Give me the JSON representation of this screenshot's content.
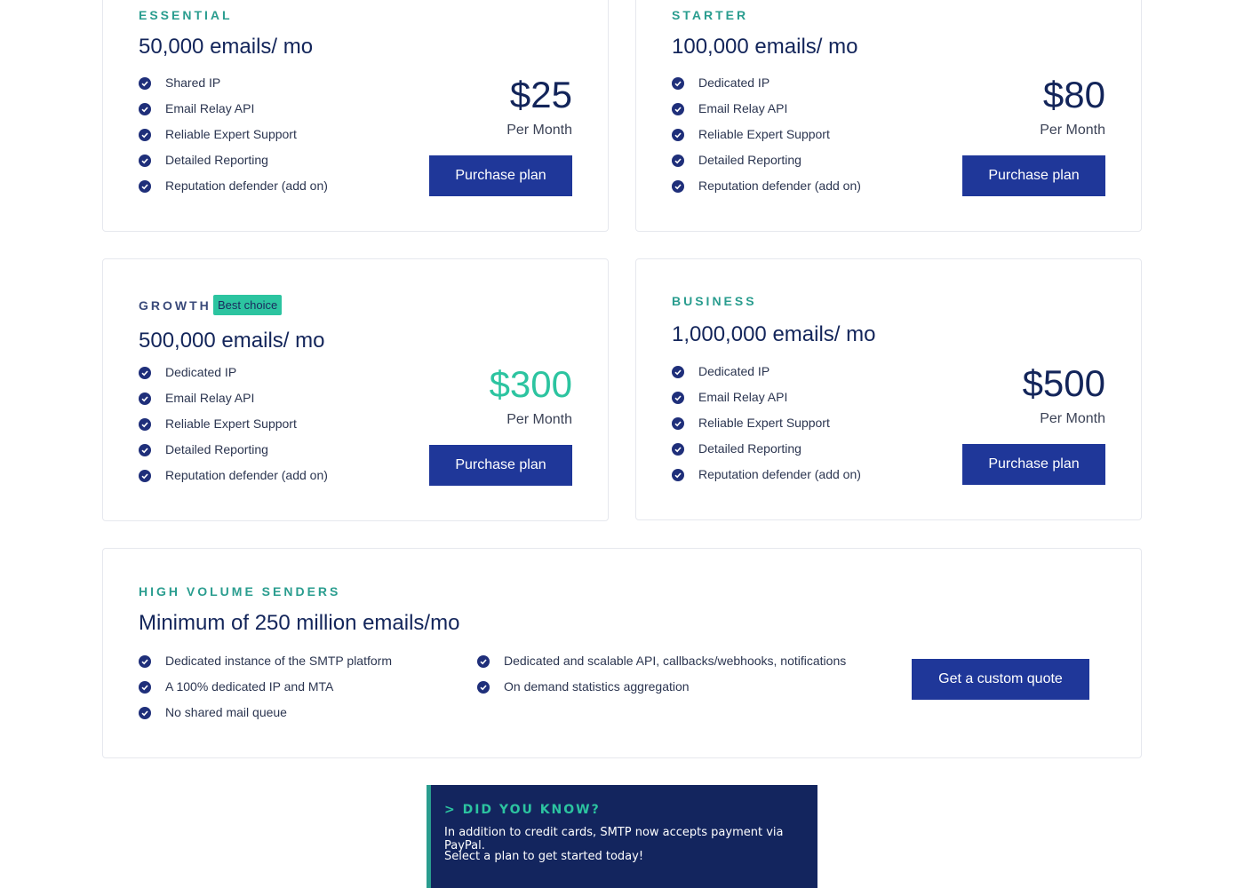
{
  "colors": {
    "navy": "#13255a",
    "button": "#1f3799",
    "teal": "#2a9d8f",
    "accent": "#2cc4a0",
    "check": "#1f2f7a"
  },
  "check_icon": "check-circle-icon",
  "plans": [
    {
      "tier": "ESSENTIAL",
      "volume": "50,000 emails/ mo",
      "features": [
        "Shared IP",
        "Email Relay API",
        "Reliable Expert Support",
        "Detailed Reporting",
        "Reputation defender (add on)"
      ],
      "price": "$25",
      "per": "Per Month",
      "button": "Purchase plan"
    },
    {
      "tier": "STARTER",
      "volume": "100,000 emails/ mo",
      "features": [
        "Dedicated IP",
        "Email Relay API",
        "Reliable Expert Support",
        "Detailed Reporting",
        "Reputation defender (add on)"
      ],
      "price": "$80",
      "per": "Per Month",
      "button": "Purchase plan"
    },
    {
      "tier": "GROWTH",
      "badge": "Best choice",
      "volume": "500,000 emails/ mo",
      "features": [
        "Dedicated IP",
        "Email Relay API",
        "Reliable Expert Support",
        "Detailed Reporting",
        "Reputation defender (add on)"
      ],
      "price": "$300",
      "per": "Per Month",
      "button": "Purchase plan"
    },
    {
      "tier": "BUSINESS",
      "volume": "1,000,000 emails/ mo",
      "features": [
        "Dedicated IP",
        "Email Relay API",
        "Reliable Expert Support",
        "Detailed Reporting",
        "Reputation defender (add on)"
      ],
      "price": "$500",
      "per": "Per Month",
      "button": "Purchase plan"
    }
  ],
  "high_volume": {
    "tier": "HIGH VOLUME SENDERS",
    "volume": "Minimum of 250 million emails/mo",
    "features_left": [
      "Dedicated instance of the SMTP platform",
      "A 100% dedicated IP and MTA",
      "No shared mail queue"
    ],
    "features_right": [
      "Dedicated and scalable API, callbacks/webhooks, notifications",
      "On demand statistics aggregation"
    ],
    "button": "Get a custom quote"
  },
  "did_you_know": {
    "title": "> DID YOU KNOW?",
    "line1": "In addition to credit cards, SMTP now accepts payment via PayPal.",
    "line2": "Select a plan to get started today!"
  }
}
